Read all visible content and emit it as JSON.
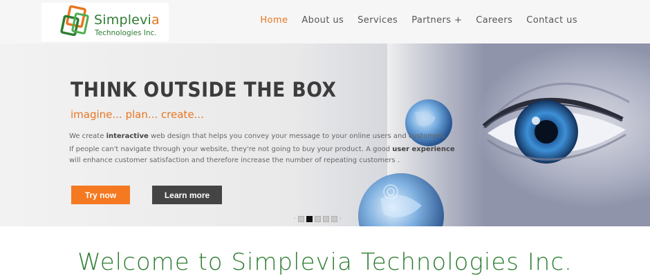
{
  "header": {
    "logo": {
      "name_main": "Simplevi",
      "name_accent": "a",
      "subtitle": "Technologies Inc."
    },
    "nav": [
      {
        "label": "Home",
        "active": true
      },
      {
        "label": "About us",
        "active": false
      },
      {
        "label": "Services",
        "active": false
      },
      {
        "label": "Partners +",
        "active": false
      },
      {
        "label": "Careers",
        "active": false
      },
      {
        "label": "Contact us",
        "active": false
      }
    ]
  },
  "hero": {
    "title": "THINK OUTSIDE THE BOX",
    "tagline": "imagine... plan... create...",
    "p1": {
      "before": "We create ",
      "bold": "interactive",
      "after": " web design that helps you convey your message to your online users and customers."
    },
    "p2": {
      "before": "If people can't navigate through your website, they're not going to buy your product. A good ",
      "bold": "user experience",
      "line2": "will enhance customer satisfaction and therefore increase the number of repeating customers ."
    },
    "buttons": {
      "try_now": "Try now",
      "learn_more": "Learn more"
    },
    "slider": {
      "prev_icon": "chevron-left-icon",
      "next_icon": "chevron-right-icon",
      "slide_count": 5,
      "active_index": 1
    }
  },
  "welcome": {
    "heading": "Welcome to Simplevia Technologies Inc."
  },
  "colors": {
    "accent_orange": "#f47920",
    "brand_green": "#2e7d32",
    "dark_button": "#444444"
  }
}
